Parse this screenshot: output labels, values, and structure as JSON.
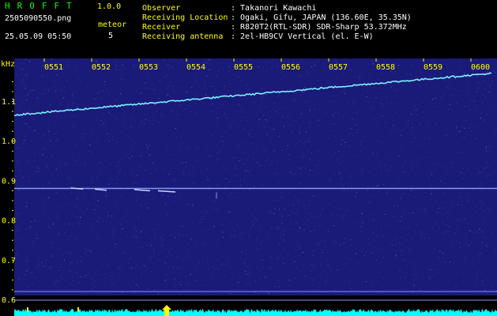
{
  "header": {
    "brand": "HROFFT",
    "version": "1.0.0",
    "filename": "2505090550.png",
    "datetime": "25.05.09 05:50",
    "meteor_label": "meteor",
    "meteor_count": "5",
    "info": [
      {
        "label": "Observer",
        "value": ": Takanori Kawachi"
      },
      {
        "label": "Receiving Location",
        "value": ": Ogaki, Gifu, JAPAN (136.60E, 35.35N)"
      },
      {
        "label": "Receiver",
        "value": ": R820T2(RTL-SDR) SDR-Sharp 53.372MHz"
      },
      {
        "label": "Receiving antenna",
        "value": ": 2el-HB9CV Vertical (el. E-W)"
      }
    ]
  },
  "colors": {
    "background": "#000000",
    "spectrogram_bg": "#1a1a78",
    "noise": "#3a3ac8",
    "trace": "#7ff0ff",
    "gridline": "#9090ff",
    "label_yellow": "#ffff00",
    "label_green": "#00ff00",
    "amplitude": "#00ffff",
    "marker": "#ffff00"
  },
  "spectrogram": {
    "unit_label": "kHz",
    "time_ticks": [
      "0551",
      "0552",
      "0553",
      "0554",
      "0555",
      "0556",
      "0557",
      "0558",
      "0559",
      "0600"
    ],
    "freq_ticks": [
      "1.1",
      "1.0",
      "0.9",
      "0.8",
      "0.7",
      "0.6"
    ]
  }
}
